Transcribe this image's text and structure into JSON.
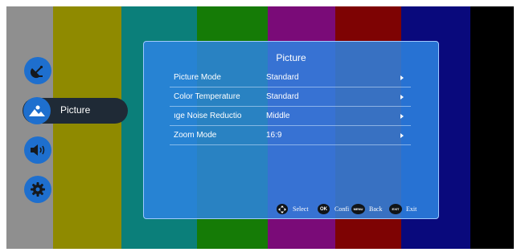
{
  "menu": {
    "items": [
      {
        "name": "satellite"
      },
      {
        "name": "picture",
        "label": "Picture"
      },
      {
        "name": "sound"
      },
      {
        "name": "settings"
      }
    ]
  },
  "panel": {
    "title": "Picture",
    "rows": [
      {
        "label": "Picture Mode",
        "value": "Standard"
      },
      {
        "label": "Color Temperature",
        "value": "Standard"
      },
      {
        "label": "ıge Noise Reductio",
        "value": "Middle"
      },
      {
        "label": "Zoom Mode",
        "value": "16:9"
      }
    ]
  },
  "help": {
    "select": "Select",
    "ok_key": "OK",
    "confirm": "Confi",
    "menu_key": "MENU",
    "back": "Back",
    "exit_key": "EXIT",
    "exit": "Exit"
  }
}
